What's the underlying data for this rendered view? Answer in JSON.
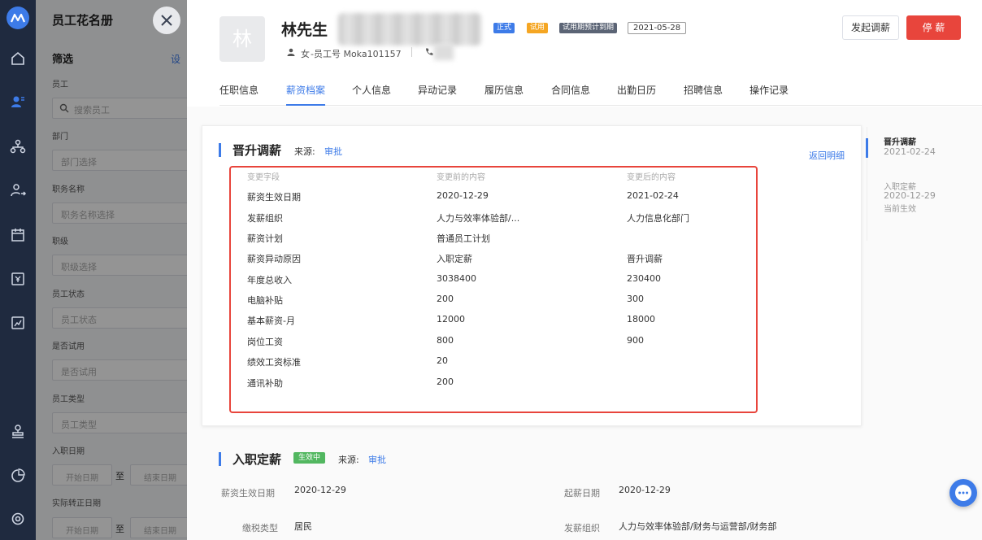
{
  "colors": {
    "accent": "#3d7be8",
    "danger": "#e8453c",
    "success": "#52b760",
    "warning": "#f5a623",
    "rail": "#1f2a3f"
  },
  "icons": {
    "rail": [
      "logo-icon",
      "home-icon",
      "people-icon",
      "org-chart-icon",
      "user-transfer-icon",
      "calendar-icon",
      "payslip-icon",
      "report-icon",
      "stamp-icon",
      "pie-chart-icon",
      "settings-icon"
    ],
    "other": [
      "search-icon",
      "close-icon",
      "person-icon",
      "phone-icon",
      "chat-icon"
    ]
  },
  "filter_panel": {
    "title": "员工花名册",
    "section": "筛选",
    "settings_link": "设",
    "fields": [
      {
        "label": "员工",
        "placeholder": "搜索员工"
      },
      {
        "label": "部门",
        "placeholder": "部门选择"
      },
      {
        "label": "职务名称",
        "placeholder": "职务名称选择"
      },
      {
        "label": "职级",
        "placeholder": "职级选择"
      },
      {
        "label": "员工状态",
        "placeholder": "员工状态"
      },
      {
        "label": "是否试用",
        "placeholder": "是否试用"
      },
      {
        "label": "员工类型",
        "placeholder": "员工类型"
      }
    ],
    "date_ranges": [
      {
        "label": "入职日期",
        "start": "开始日期",
        "sep": "至",
        "end": "结束日期"
      },
      {
        "label": "实际转正日期",
        "start": "开始日期",
        "sep": "至",
        "end": "结束日期"
      }
    ]
  },
  "profile": {
    "avatar_char": "林",
    "name": "林先生",
    "badges": [
      "正式",
      "试用",
      "试用期预计到期"
    ],
    "probation_date": "2021-05-28",
    "gender": "女",
    "employee_no": "-员工号 Moka101157",
    "actions": {
      "adjust": "发起调薪",
      "stop": "停 薪"
    }
  },
  "tabs": [
    "任职信息",
    "薪资档案",
    "个人信息",
    "异动记录",
    "履历信息",
    "合同信息",
    "出勤日历",
    "招聘信息",
    "操作记录"
  ],
  "active_tab": "薪资档案",
  "promotion_card": {
    "title": "晋升调薪",
    "source_label": "来源:",
    "source_link": "审批",
    "back_link": "返回明细",
    "headers": [
      "变更字段",
      "变更前的内容",
      "变更后的内容"
    ],
    "rows": [
      [
        "薪资生效日期",
        "2020-12-29",
        "2021-02-24"
      ],
      [
        "发薪组织",
        "人力与效率体验部/...",
        "人力信息化部门"
      ],
      [
        "薪资计划",
        "普通员工计划",
        ""
      ],
      [
        "薪资异动原因",
        "入职定薪",
        "晋升调薪"
      ],
      [
        "年度总收入",
        "3038400",
        "230400"
      ],
      [
        "电脑补贴",
        "200",
        "300"
      ],
      [
        "基本薪资-月",
        "12000",
        "18000"
      ],
      [
        "岗位工资",
        "800",
        "900"
      ],
      [
        "绩效工资标准",
        "20",
        ""
      ],
      [
        "通讯补助",
        "200",
        ""
      ]
    ]
  },
  "timeline": [
    {
      "title": "晋升调薪",
      "date": "2021-02-24",
      "note": ""
    },
    {
      "title": "入职定薪",
      "date": "2020-12-29",
      "note": "当前生效"
    }
  ],
  "onboarding": {
    "title": "入职定薪",
    "status": "生效中",
    "source_label": "来源:",
    "source_link": "审批",
    "fields": {
      "effective_date_label": "薪资生效日期",
      "effective_date": "2020-12-29",
      "start_date_label": "起薪日期",
      "start_date": "2020-12-29",
      "tax_type_label": "缴税类型",
      "tax_type": "居民",
      "pay_org_label": "发薪组织",
      "pay_org": "人力与效率体验部/财务与运营部/财务部"
    }
  }
}
